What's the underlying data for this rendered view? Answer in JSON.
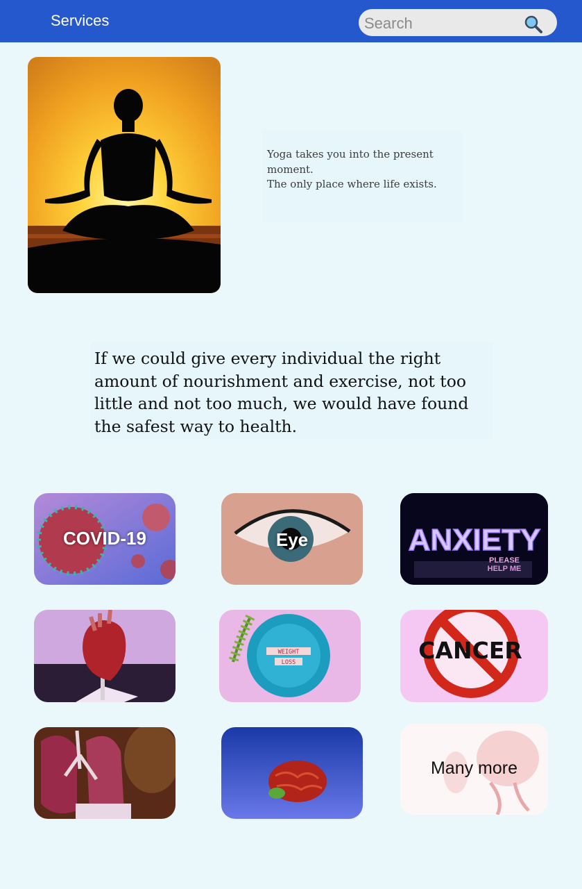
{
  "header": {
    "title": "Services",
    "search_placeholder": "Search",
    "search_icon": "magnifier-icon"
  },
  "quotes": {
    "yoga": "Yoga takes you into the present moment.\n The only place where life exists.",
    "health": " If we could give every individual the right amount of nourishment and exercise, not too little and not too much, we would have found the safest way to health."
  },
  "services": [
    {
      "label": "COVID-19",
      "image": "virus"
    },
    {
      "label": "Eye",
      "image": "eye"
    },
    {
      "label": "",
      "image": "anxiety-neon"
    },
    {
      "label": "",
      "image": "heart-model"
    },
    {
      "label": "",
      "image": "weight-loss-plate"
    },
    {
      "label": "",
      "image": "cancer-sign"
    },
    {
      "label": "",
      "image": "lungs-model"
    },
    {
      "label": "",
      "image": "brain-model"
    },
    {
      "label": "Many more",
      "image": "anatomy-sketch"
    }
  ],
  "image_text": {
    "anxiety": "ANXIETY",
    "anxiety_sub1": "PLEASE",
    "anxiety_sub2": "HELP ME",
    "weight1": "WEIGHT",
    "weight2": "LOSS",
    "cancer": "CANCER"
  },
  "colors": {
    "header": "#2558cc",
    "background": "#eaf8fc",
    "quote_box": "#e6f6fb"
  }
}
